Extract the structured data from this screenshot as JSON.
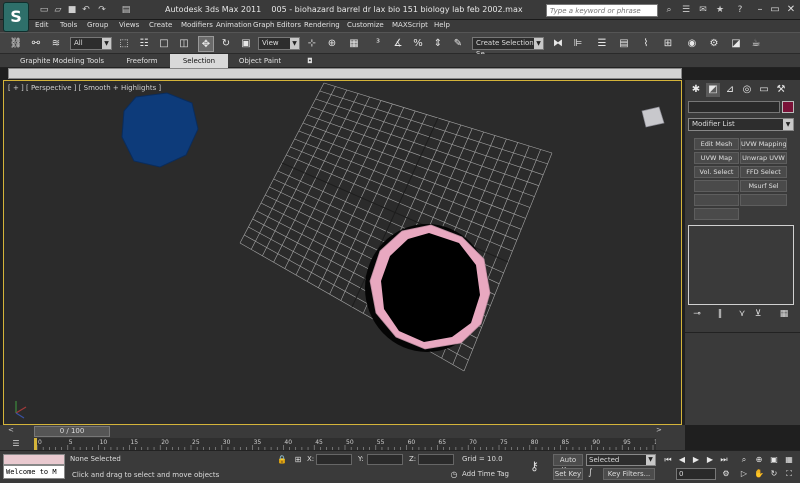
{
  "window": {
    "app_name": "Autodesk 3ds Max  2011",
    "file_name": "005 - biohazard barrel dr lax bio 151 biology lab feb 2002.max",
    "search_placeholder": "Type a keyword or phrase"
  },
  "app_logo": "S",
  "menu": [
    "Edit",
    "Tools",
    "Group",
    "Views",
    "Create",
    "Modifiers",
    "Animation",
    "Graph Editors",
    "Rendering",
    "Customize",
    "MAXScript",
    "Help"
  ],
  "toolbar": {
    "selection_filter": "All",
    "reference_coord": "View",
    "named_selection_placeholder": "Create Selection Se"
  },
  "ribbon_tabs": [
    {
      "label": "Graphite Modeling Tools",
      "active": false
    },
    {
      "label": "Freeform",
      "active": false
    },
    {
      "label": "Selection",
      "active": true
    },
    {
      "label": "Object Paint",
      "active": false
    }
  ],
  "viewport": {
    "label": "[ + ] [ Perspective ] [ Smooth + Highlights ]"
  },
  "command_panel": {
    "modifier_list": "Modifier List",
    "modifier_buttons": [
      "Edit Mesh",
      "UVW Mapping Ad",
      "UVW Map",
      "Unwrap UVW",
      "Vol. Select",
      "FFD Select",
      "",
      "Msurf Sel",
      "",
      "",
      ""
    ],
    "swatch_color": "#7a1238"
  },
  "trackbar": {
    "time_slider": "0 / 100",
    "prev": "<",
    "next": ">",
    "ticks": [
      "0",
      "5",
      "10",
      "15",
      "20",
      "25",
      "30",
      "35",
      "40",
      "45",
      "50",
      "55",
      "60",
      "65",
      "70",
      "75",
      "80",
      "85",
      "90",
      "95",
      "100"
    ]
  },
  "status": {
    "listener_text": "Welcome to M",
    "selection": "None Selected",
    "prompt": "Click and drag to select and move objects",
    "x_label": "X:",
    "y_label": "Y:",
    "z_label": "Z:",
    "grid": "Grid = 10.0",
    "add_time_tag": "Add Time Tag",
    "auto_key": "Auto Key",
    "set_key": "Set Key",
    "key_mode": "Selected",
    "key_filters": "Key Filters...",
    "frame": "0"
  },
  "colors": {
    "accent_selected_border": "#d4b43a",
    "barrel_rim": "#e8a8c0",
    "sphere": "#0d3b7a"
  }
}
